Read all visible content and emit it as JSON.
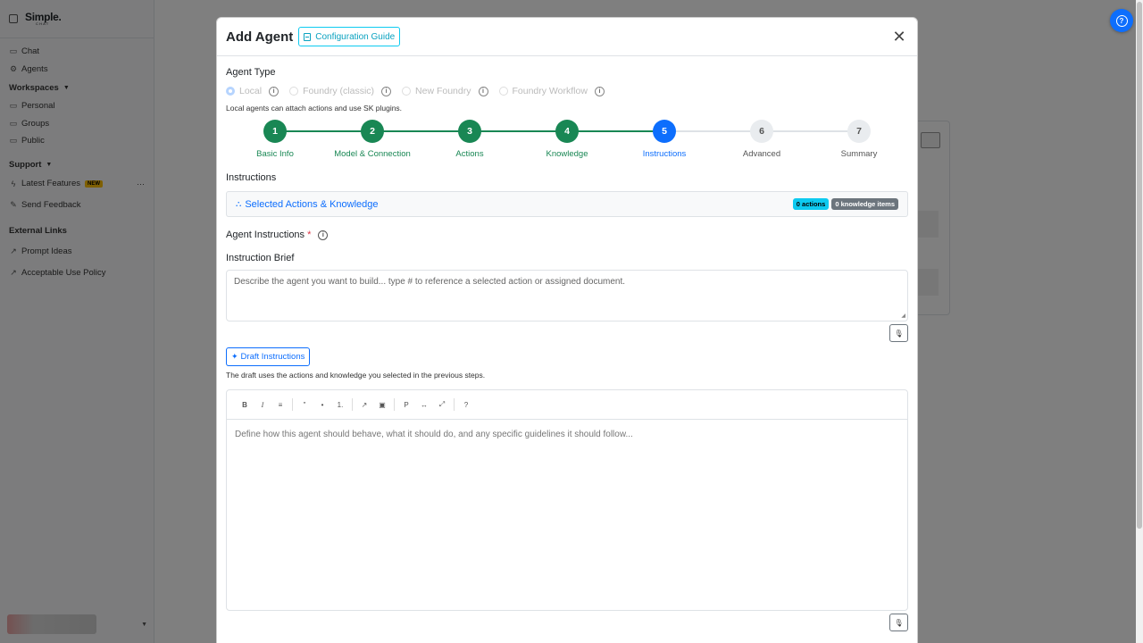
{
  "sidebar": {
    "brand_line1": "Simple.",
    "brand_line2": "CHAT",
    "items": [
      {
        "label": "Chat",
        "icon": "chat-icon"
      },
      {
        "label": "Agents",
        "icon": "agents-icon"
      }
    ],
    "workspaces_label": "Workspaces",
    "workspaces": [
      {
        "label": "Personal",
        "icon": "folder-icon"
      },
      {
        "label": "Groups",
        "icon": "folder-icon"
      },
      {
        "label": "Public",
        "icon": "folder-icon"
      }
    ],
    "support_label": "Support",
    "support_items": [
      {
        "label": "Latest Features",
        "badge": "NEW",
        "icon": "lightning-icon"
      },
      {
        "label": "Send Feedback",
        "icon": "feedback-icon"
      }
    ],
    "external_label": "External Links",
    "external_items": [
      {
        "label": "Prompt Ideas",
        "icon": "external-link-icon"
      },
      {
        "label": "Acceptable Use Policy",
        "icon": "external-link-icon"
      }
    ]
  },
  "modal": {
    "title": "Add Agent",
    "guide_label": "Configuration Guide",
    "agent_type_label": "Agent Type",
    "agent_types": [
      {
        "label": "Local",
        "checked": true
      },
      {
        "label": "Foundry (classic)",
        "checked": false
      },
      {
        "label": "New Foundry",
        "checked": false
      },
      {
        "label": "Foundry Workflow",
        "checked": false
      }
    ],
    "agent_type_hint": "Local agents can attach actions and use SK plugins.",
    "steps": [
      {
        "num": "1",
        "label": "Basic Info",
        "state": "done"
      },
      {
        "num": "2",
        "label": "Model & Connection",
        "state": "done"
      },
      {
        "num": "3",
        "label": "Actions",
        "state": "done"
      },
      {
        "num": "4",
        "label": "Knowledge",
        "state": "done"
      },
      {
        "num": "5",
        "label": "Instructions",
        "state": "active"
      },
      {
        "num": "6",
        "label": "Advanced",
        "state": "todo"
      },
      {
        "num": "7",
        "label": "Summary",
        "state": "todo"
      }
    ],
    "section_title": "Instructions",
    "selected_label": "Selected Actions & Knowledge",
    "actions_badge": "0 actions",
    "knowledge_badge": "0 knowledge items",
    "agent_instructions_label": "Agent Instructions",
    "required_mark": "*",
    "instruction_brief_label": "Instruction Brief",
    "brief_placeholder": "Describe the agent you want to build... type # to reference a selected action or assigned document.",
    "draft_button": "Draft Instructions",
    "draft_hint": "The draft uses the actions and knowledge you selected in the previous steps.",
    "editor_placeholder": "Define how this agent should behave, what it should do, and any specific guidelines it should follow...",
    "toolbar": [
      "B",
      "I",
      "≡",
      "\"",
      "•",
      "1.",
      "↗",
      "▣",
      "P",
      "↔",
      "⤢",
      "?"
    ]
  },
  "colors": {
    "success": "#198754",
    "primary": "#0d6efd",
    "info": "#0dcaf0",
    "secondary": "#6c757d"
  }
}
